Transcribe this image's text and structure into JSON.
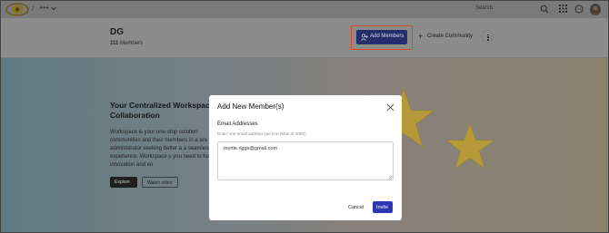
{
  "topbar": {
    "breadcrumb_separator": "/",
    "breadcrumb_current": "•••",
    "search": {
      "placeholder": "Search"
    }
  },
  "community": {
    "name": "DG",
    "member_count": "111",
    "member_label": "Members"
  },
  "actions": {
    "add_members_label": "Add Members",
    "create_community_label": "Create Community"
  },
  "banner": {
    "title": "Your Centralized Workspace Collaboration",
    "text": "Workspace is your one-stop solution communities and their members in a are an administrator seeking better a a seamless experience, Workspace p you need to foster innovation and en",
    "explore_label": "Explore",
    "watch_label": "Watch video"
  },
  "modal": {
    "title": "Add New Member(s)",
    "field_label": "Email Addresses",
    "field_hint": "Enter one email address per line (Max of 3000)",
    "email_value": "myrtle.riggs@gmail.com",
    "cancel_label": "Cancel",
    "invite_label": "Invite"
  },
  "colors": {
    "primary_button": "#2d36b3",
    "highlight_border": "#d94a2a",
    "overlay": "#8c8c8c",
    "star": "#c9a52a"
  },
  "icons": [
    "logo",
    "chevron-down-icon",
    "search-icon",
    "grid-icon",
    "chat-icon",
    "avatar",
    "add-user-icon",
    "plus-icon",
    "more-vertical-icon",
    "close-icon",
    "star-decoration"
  ]
}
